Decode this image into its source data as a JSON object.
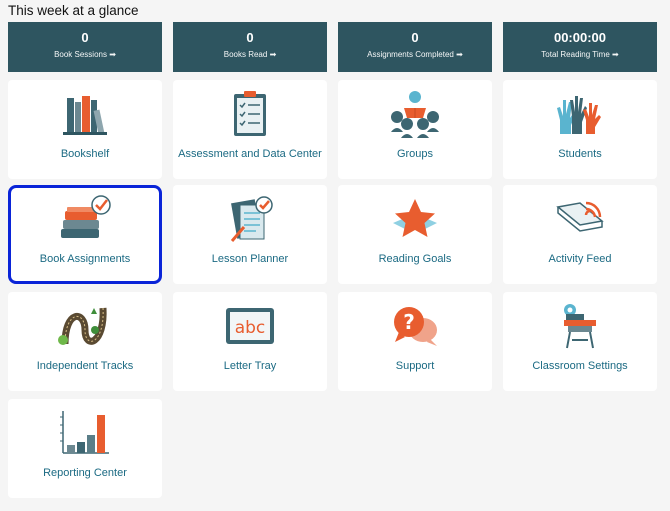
{
  "page": {
    "heading": "This week at a glance"
  },
  "stats": [
    {
      "value": "0",
      "label": "Book Sessions",
      "arrow": "➡"
    },
    {
      "value": "0",
      "label": "Books Read",
      "arrow": "➡"
    },
    {
      "value": "0",
      "label": "Assignments Completed",
      "arrow": "➡"
    },
    {
      "value": "00:00:00",
      "label": "Total Reading Time",
      "arrow": "➡"
    }
  ],
  "tiles": [
    {
      "label": "Bookshelf",
      "icon": "bookshelf-icon"
    },
    {
      "label": "Assessment and Data Center",
      "icon": "clipboard-checklist-icon"
    },
    {
      "label": "Groups",
      "icon": "reading-group-icon"
    },
    {
      "label": "Students",
      "icon": "raised-hands-icon"
    },
    {
      "label": "Book Assignments",
      "icon": "book-stack-check-icon",
      "selected": true
    },
    {
      "label": "Lesson Planner",
      "icon": "lesson-plan-icon"
    },
    {
      "label": "Reading Goals",
      "icon": "star-icon"
    },
    {
      "label": "Activity Feed",
      "icon": "open-book-signal-icon"
    },
    {
      "label": "Independent Tracks",
      "icon": "winding-road-icon"
    },
    {
      "label": "Letter Tray",
      "icon": "letter-tray-abc-icon"
    },
    {
      "label": "Support",
      "icon": "question-bubble-icon"
    },
    {
      "label": "Classroom Settings",
      "icon": "desk-gear-icon"
    },
    {
      "label": "Reporting Center",
      "icon": "bar-chart-icon"
    }
  ],
  "colors": {
    "stat_bg": "#2e5560",
    "tile_label": "#1b6a83",
    "selected_border": "#0a24d8",
    "accent_orange": "#e85d2f",
    "accent_teal": "#3d6672"
  }
}
